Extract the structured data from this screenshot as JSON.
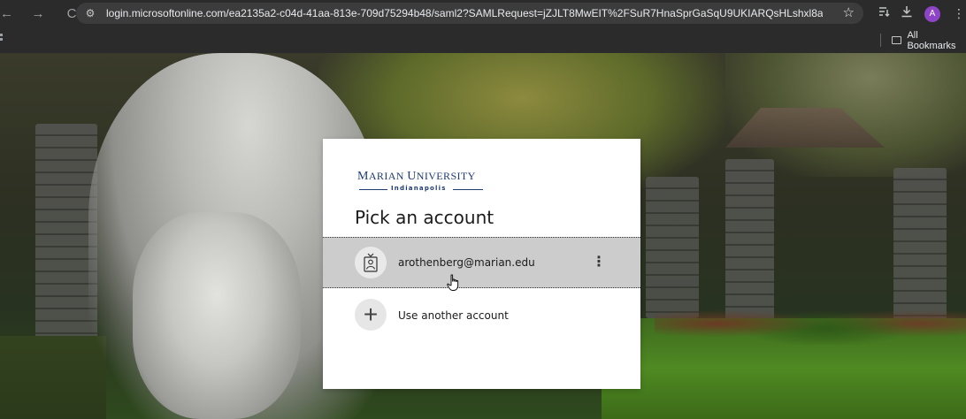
{
  "browser": {
    "back_glyph": "←",
    "forward_glyph": "→",
    "reload_glyph": "C",
    "site_info_glyph": "⚙",
    "url": "login.microsoftonline.com/ea2135a2-c04d-41aa-813e-709d75294b48/saml2?SAMLRequest=jZJLT8MwEIT%2FSuR7HnaSprGaSqU9UKIARQsHLshxl8aSYwevw%2BBP...",
    "star_glyph": "☆",
    "profile_initial": "A",
    "menu_glyph": "⋮",
    "all_bookmarks": "All Bookmarks"
  },
  "login": {
    "logo_main_first": "M",
    "logo_main_rest1": "ARIAN ",
    "logo_main_second": "U",
    "logo_main_rest2": "NIVERSITY",
    "logo_sub": "Indianapolis",
    "title": "Pick an account",
    "accounts": [
      {
        "email": "arothenberg@marian.edu",
        "icon": "badge-person-icon",
        "options_glyph": "⋮"
      }
    ],
    "use_another": {
      "label": "Use another account",
      "glyph": "+"
    }
  },
  "colors": {
    "logo_navy": "#1f3b73",
    "tile_selected_bg": "#cccccc",
    "browser_chrome": "#2b2b2b"
  }
}
